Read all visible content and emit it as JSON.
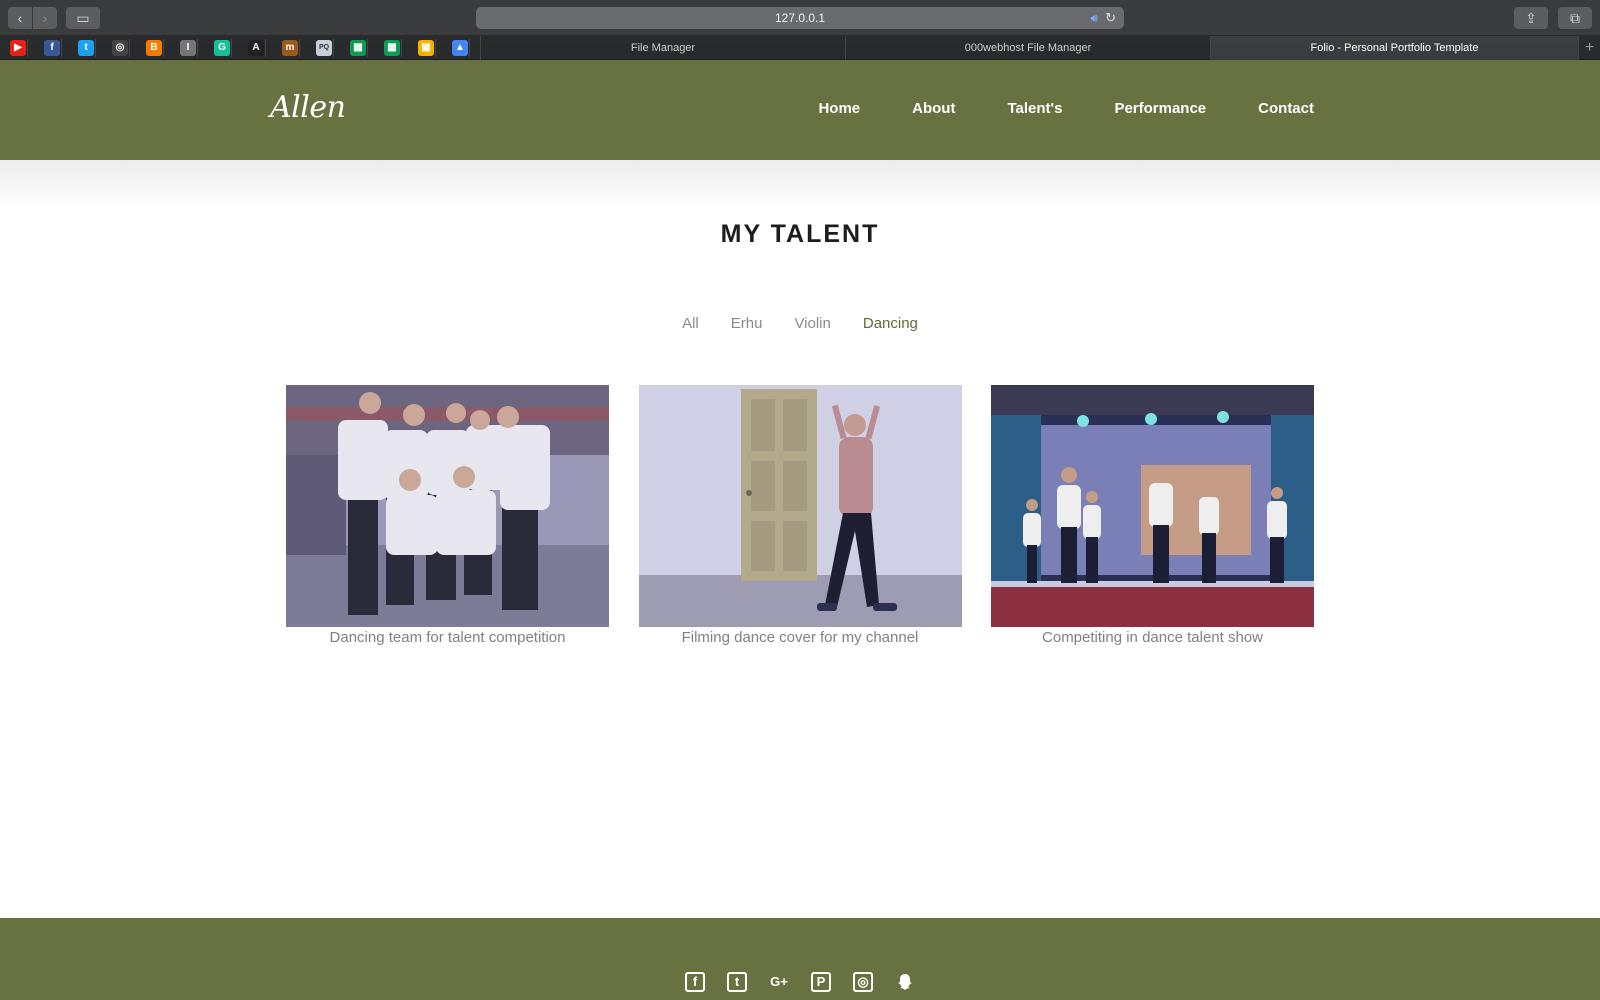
{
  "browser": {
    "address": "127.0.0.1",
    "tabs": [
      {
        "title": "File Manager",
        "active": false
      },
      {
        "title": "000webhost File Manager",
        "active": false
      },
      {
        "title": "Folio - Personal Portfolio Template",
        "active": true
      }
    ],
    "bookmarks": [
      {
        "icon": "youtube-icon",
        "color": "#e62117",
        "glyph": "▶"
      },
      {
        "icon": "facebook-icon",
        "color": "#3b5998",
        "glyph": "f"
      },
      {
        "icon": "twitter-icon",
        "color": "#1da1f2",
        "glyph": "t"
      },
      {
        "icon": "instagram-icon",
        "color": "#444444",
        "glyph": "◎"
      },
      {
        "icon": "blogger-icon",
        "color": "#f57d00",
        "glyph": "B"
      },
      {
        "icon": "generic-i-icon",
        "color": "#777777",
        "glyph": "I"
      },
      {
        "icon": "grammarly-icon",
        "color": "#15c39a",
        "glyph": "G"
      },
      {
        "icon": "font-a-icon",
        "color": "#222222",
        "glyph": "A"
      },
      {
        "icon": "mendeley-icon",
        "color": "#9b5b1f",
        "glyph": "m"
      },
      {
        "icon": "pq-icon",
        "color": "#c9d1d9",
        "glyph": "PQ"
      },
      {
        "icon": "sheets-icon",
        "color": "#0f9d58",
        "glyph": "▦"
      },
      {
        "icon": "sheets-icon-2",
        "color": "#0f9d58",
        "glyph": "▦"
      },
      {
        "icon": "slides-icon",
        "color": "#f4b400",
        "glyph": "▣"
      },
      {
        "icon": "drive-icon",
        "color": "#4285f4",
        "glyph": "▲"
      }
    ]
  },
  "site": {
    "logo": "Allen",
    "nav": [
      "Home",
      "About",
      "Talent's",
      "Performance",
      "Contact"
    ],
    "section_title": "MY TALENT",
    "filters": {
      "items": [
        "All",
        "Erhu",
        "Violin",
        "Dancing"
      ],
      "active": "Dancing"
    },
    "gallery": [
      {
        "caption": "Dancing team for talent competition"
      },
      {
        "caption": "Filming dance cover for my channel"
      },
      {
        "caption": "Competiting in dance talent show"
      }
    ],
    "socials": [
      "facebook-icon",
      "twitter-icon",
      "google-plus-icon",
      "pinterest-icon",
      "instagram-icon",
      "snapchat-icon"
    ]
  },
  "colors": {
    "brand": "#687240",
    "active_filter": "#5f6b35"
  }
}
